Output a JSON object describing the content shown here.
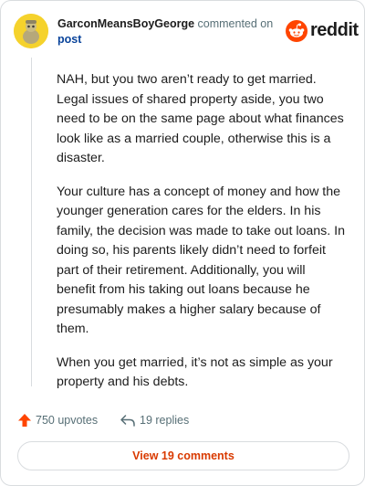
{
  "header": {
    "username": "GarconMeansBoyGeorge",
    "commented_text": "commented on",
    "post_link": "post",
    "logo_text": "reddit"
  },
  "comment": {
    "paragraphs": [
      "NAH, but you two aren’t ready to get married. Legal issues of shared property aside, you two need to be on the same page about what finances look like as a married couple, otherwise this is a disaster.",
      "Your culture has a concept of money and how the younger generation cares for the elders. In his family, the decision was made to take out loans. In doing so, his parents likely didn’t need to forfeit part of their retirement. Additionally, you will benefit from his taking out loans because he presumably makes a higher salary because of them.",
      "When you get married, it’s not as simple as your property and his debts."
    ]
  },
  "actions": {
    "upvotes": "750 upvotes",
    "replies": "19 replies",
    "view_comments": "View 19 comments"
  },
  "colors": {
    "upvote": "#ff4500",
    "link": "#0a449b",
    "view_button": "#d93a00"
  }
}
